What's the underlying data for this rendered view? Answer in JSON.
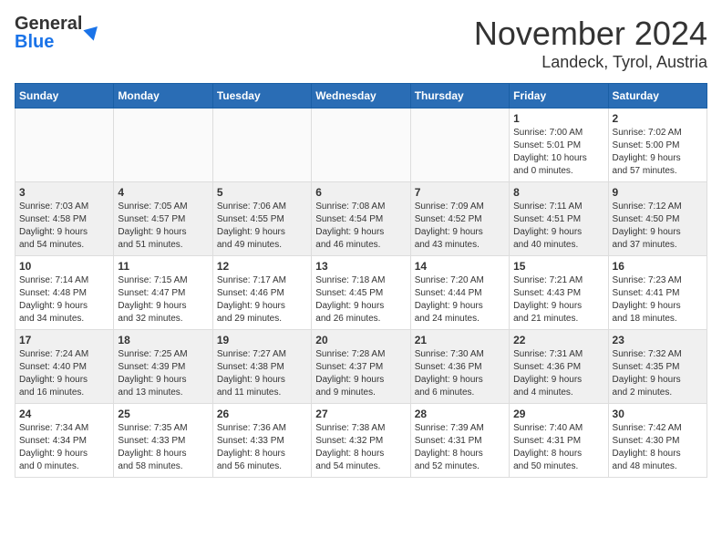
{
  "header": {
    "logo_line1": "General",
    "logo_line2": "Blue",
    "month": "November 2024",
    "location": "Landeck, Tyrol, Austria"
  },
  "weekdays": [
    "Sunday",
    "Monday",
    "Tuesday",
    "Wednesday",
    "Thursday",
    "Friday",
    "Saturday"
  ],
  "weeks": [
    [
      {
        "day": "",
        "info": ""
      },
      {
        "day": "",
        "info": ""
      },
      {
        "day": "",
        "info": ""
      },
      {
        "day": "",
        "info": ""
      },
      {
        "day": "",
        "info": ""
      },
      {
        "day": "1",
        "info": "Sunrise: 7:00 AM\nSunset: 5:01 PM\nDaylight: 10 hours\nand 0 minutes."
      },
      {
        "day": "2",
        "info": "Sunrise: 7:02 AM\nSunset: 5:00 PM\nDaylight: 9 hours\nand 57 minutes."
      }
    ],
    [
      {
        "day": "3",
        "info": "Sunrise: 7:03 AM\nSunset: 4:58 PM\nDaylight: 9 hours\nand 54 minutes."
      },
      {
        "day": "4",
        "info": "Sunrise: 7:05 AM\nSunset: 4:57 PM\nDaylight: 9 hours\nand 51 minutes."
      },
      {
        "day": "5",
        "info": "Sunrise: 7:06 AM\nSunset: 4:55 PM\nDaylight: 9 hours\nand 49 minutes."
      },
      {
        "day": "6",
        "info": "Sunrise: 7:08 AM\nSunset: 4:54 PM\nDaylight: 9 hours\nand 46 minutes."
      },
      {
        "day": "7",
        "info": "Sunrise: 7:09 AM\nSunset: 4:52 PM\nDaylight: 9 hours\nand 43 minutes."
      },
      {
        "day": "8",
        "info": "Sunrise: 7:11 AM\nSunset: 4:51 PM\nDaylight: 9 hours\nand 40 minutes."
      },
      {
        "day": "9",
        "info": "Sunrise: 7:12 AM\nSunset: 4:50 PM\nDaylight: 9 hours\nand 37 minutes."
      }
    ],
    [
      {
        "day": "10",
        "info": "Sunrise: 7:14 AM\nSunset: 4:48 PM\nDaylight: 9 hours\nand 34 minutes."
      },
      {
        "day": "11",
        "info": "Sunrise: 7:15 AM\nSunset: 4:47 PM\nDaylight: 9 hours\nand 32 minutes."
      },
      {
        "day": "12",
        "info": "Sunrise: 7:17 AM\nSunset: 4:46 PM\nDaylight: 9 hours\nand 29 minutes."
      },
      {
        "day": "13",
        "info": "Sunrise: 7:18 AM\nSunset: 4:45 PM\nDaylight: 9 hours\nand 26 minutes."
      },
      {
        "day": "14",
        "info": "Sunrise: 7:20 AM\nSunset: 4:44 PM\nDaylight: 9 hours\nand 24 minutes."
      },
      {
        "day": "15",
        "info": "Sunrise: 7:21 AM\nSunset: 4:43 PM\nDaylight: 9 hours\nand 21 minutes."
      },
      {
        "day": "16",
        "info": "Sunrise: 7:23 AM\nSunset: 4:41 PM\nDaylight: 9 hours\nand 18 minutes."
      }
    ],
    [
      {
        "day": "17",
        "info": "Sunrise: 7:24 AM\nSunset: 4:40 PM\nDaylight: 9 hours\nand 16 minutes."
      },
      {
        "day": "18",
        "info": "Sunrise: 7:25 AM\nSunset: 4:39 PM\nDaylight: 9 hours\nand 13 minutes."
      },
      {
        "day": "19",
        "info": "Sunrise: 7:27 AM\nSunset: 4:38 PM\nDaylight: 9 hours\nand 11 minutes."
      },
      {
        "day": "20",
        "info": "Sunrise: 7:28 AM\nSunset: 4:37 PM\nDaylight: 9 hours\nand 9 minutes."
      },
      {
        "day": "21",
        "info": "Sunrise: 7:30 AM\nSunset: 4:36 PM\nDaylight: 9 hours\nand 6 minutes."
      },
      {
        "day": "22",
        "info": "Sunrise: 7:31 AM\nSunset: 4:36 PM\nDaylight: 9 hours\nand 4 minutes."
      },
      {
        "day": "23",
        "info": "Sunrise: 7:32 AM\nSunset: 4:35 PM\nDaylight: 9 hours\nand 2 minutes."
      }
    ],
    [
      {
        "day": "24",
        "info": "Sunrise: 7:34 AM\nSunset: 4:34 PM\nDaylight: 9 hours\nand 0 minutes."
      },
      {
        "day": "25",
        "info": "Sunrise: 7:35 AM\nSunset: 4:33 PM\nDaylight: 8 hours\nand 58 minutes."
      },
      {
        "day": "26",
        "info": "Sunrise: 7:36 AM\nSunset: 4:33 PM\nDaylight: 8 hours\nand 56 minutes."
      },
      {
        "day": "27",
        "info": "Sunrise: 7:38 AM\nSunset: 4:32 PM\nDaylight: 8 hours\nand 54 minutes."
      },
      {
        "day": "28",
        "info": "Sunrise: 7:39 AM\nSunset: 4:31 PM\nDaylight: 8 hours\nand 52 minutes."
      },
      {
        "day": "29",
        "info": "Sunrise: 7:40 AM\nSunset: 4:31 PM\nDaylight: 8 hours\nand 50 minutes."
      },
      {
        "day": "30",
        "info": "Sunrise: 7:42 AM\nSunset: 4:30 PM\nDaylight: 8 hours\nand 48 minutes."
      }
    ]
  ]
}
